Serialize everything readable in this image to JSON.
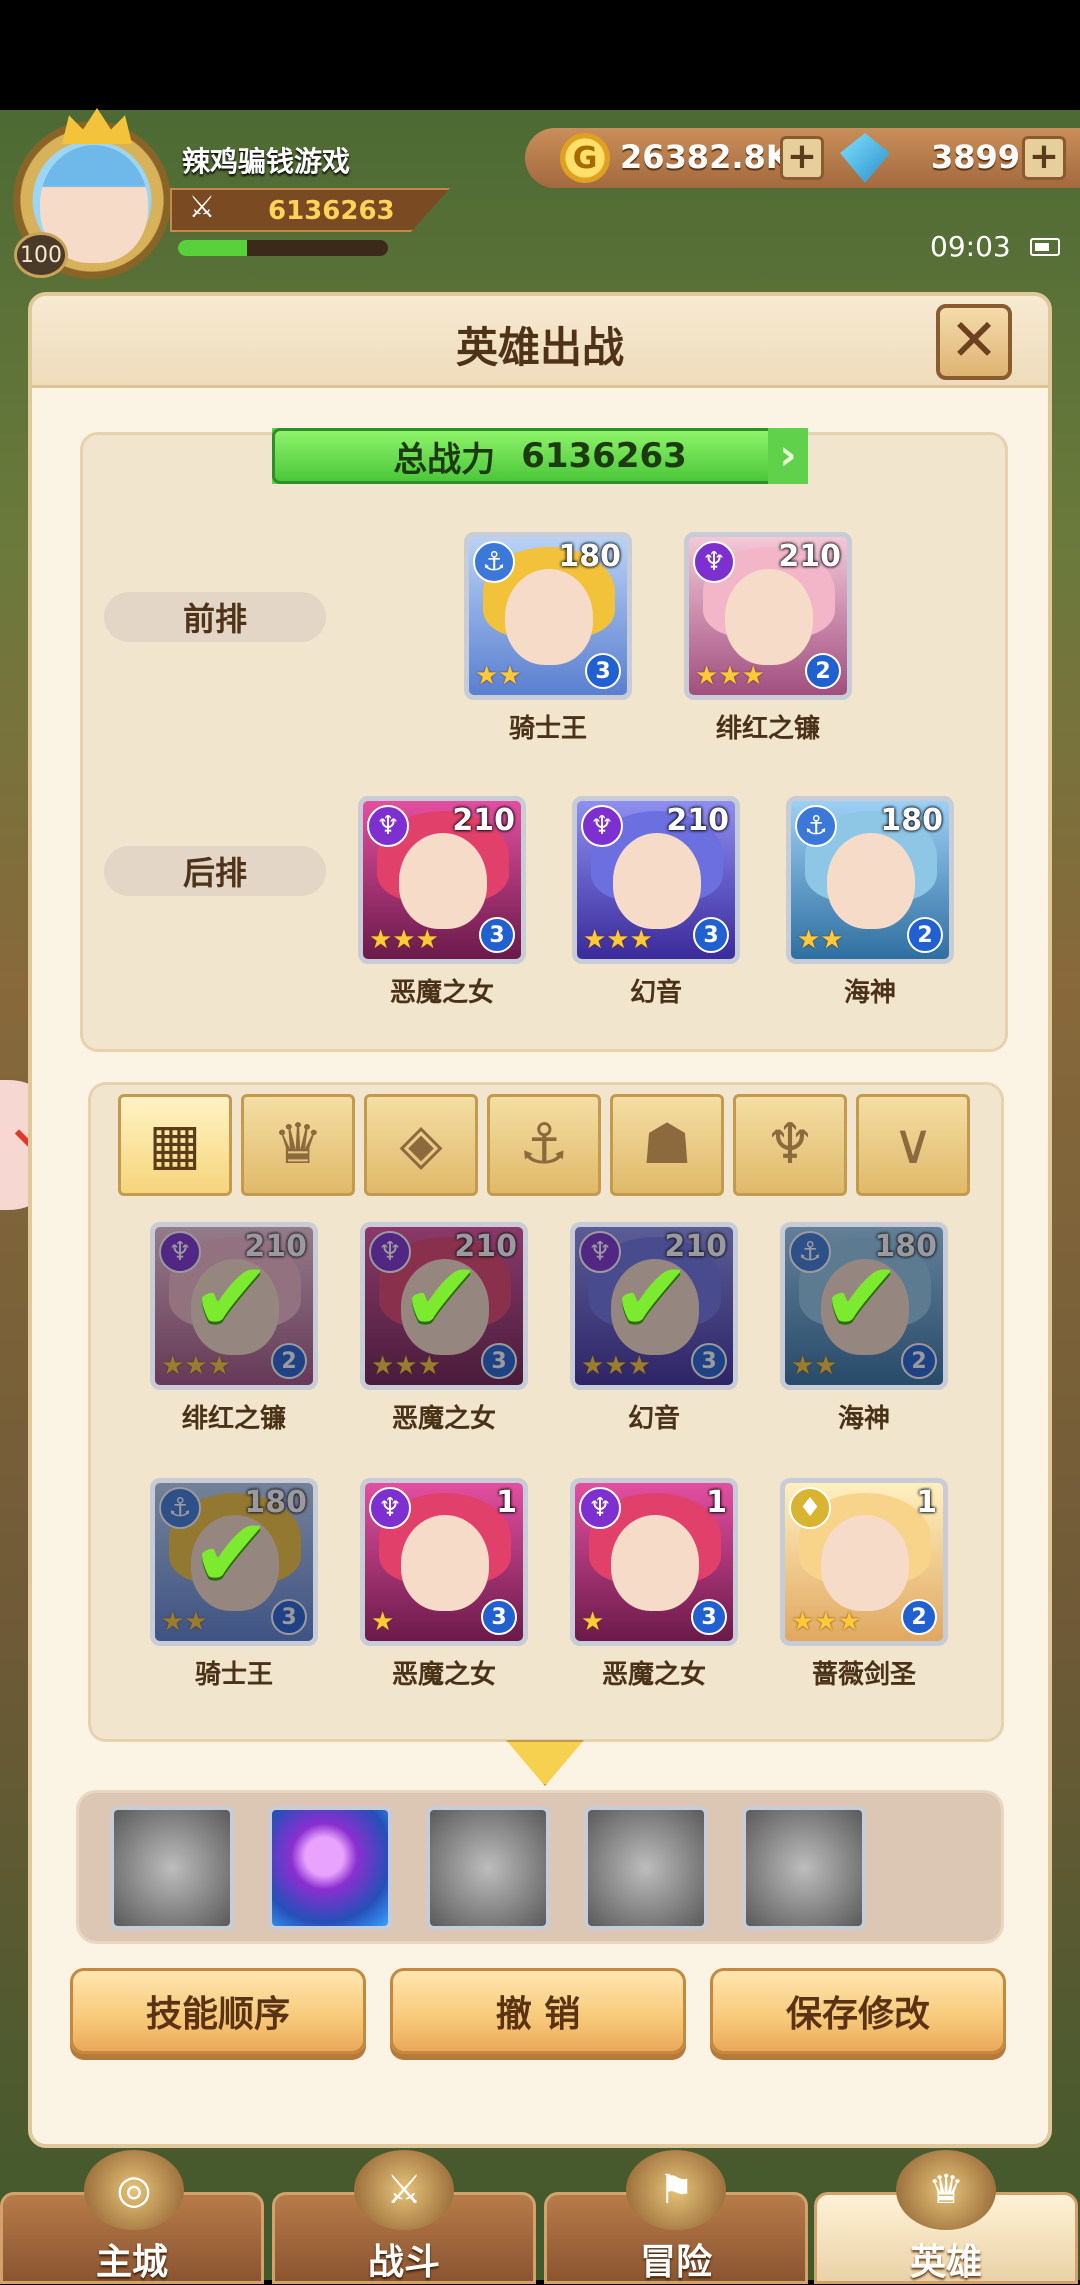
{
  "player": {
    "name": "辣鸡骗钱游戏",
    "level": "100",
    "power": "6136263",
    "exp_fraction": 0.33
  },
  "resources": {
    "gold": "26382.8K",
    "gems": "3899",
    "gold_symbol": "G"
  },
  "status": {
    "time": "09:03"
  },
  "dialog": {
    "title": "英雄出战",
    "close_symbol": "✕"
  },
  "formation": {
    "total_label": "总战力",
    "total_value": "6136263",
    "front_label": "前排",
    "back_label": "后排",
    "front": [
      {
        "name": "骑士王",
        "level": "180",
        "stars": "★★",
        "rank": "3",
        "type_symbol": "⚓",
        "type_color": "#3b78d8"
      },
      {
        "name": "绯红之镰",
        "level": "210",
        "stars": "★★★",
        "rank": "2",
        "type_symbol": "♆",
        "type_color": "#7d2fd0"
      }
    ],
    "back": [
      {
        "name": "恶魔之女",
        "level": "210",
        "stars": "★★★",
        "rank": "3",
        "type_symbol": "♆",
        "type_color": "#7d2fd0"
      },
      {
        "name": "幻音",
        "level": "210",
        "stars": "★★★",
        "rank": "3",
        "type_symbol": "♆",
        "type_color": "#7d2fd0"
      },
      {
        "name": "海神",
        "level": "180",
        "stars": "★★",
        "rank": "2",
        "type_symbol": "⚓",
        "type_color": "#3b78d8"
      }
    ]
  },
  "filters": [
    "▦",
    "♛",
    "◈",
    "⚓",
    "☗",
    "♆",
    "∨"
  ],
  "roster": [
    {
      "name": "绯红之镰",
      "level": "210",
      "stars": "★★★",
      "rank": "2",
      "selected": true
    },
    {
      "name": "恶魔之女",
      "level": "210",
      "stars": "★★★",
      "rank": "3",
      "selected": true
    },
    {
      "name": "幻音",
      "level": "210",
      "stars": "★★★",
      "rank": "3",
      "selected": true
    },
    {
      "name": "海神",
      "level": "180",
      "stars": "★★",
      "rank": "2",
      "selected": true
    },
    {
      "name": "骑士王",
      "level": "180",
      "stars": "★★",
      "rank": "3",
      "selected": true
    },
    {
      "name": "恶魔之女",
      "level": "1",
      "stars": "★",
      "rank": "3",
      "selected": false
    },
    {
      "name": "恶魔之女",
      "level": "1",
      "stars": "★",
      "rank": "3",
      "selected": false
    },
    {
      "name": "蔷薇剑圣",
      "level": "1",
      "stars": "★★★",
      "rank": "2",
      "selected": false
    }
  ],
  "check_symbol": "✔",
  "buttons": {
    "skill_order": "技能顺序",
    "undo": "撤 销",
    "save": "保存修改"
  },
  "nav": {
    "city": "主城",
    "battle": "战斗",
    "adventure": "冒险",
    "heroes": "英雄"
  }
}
